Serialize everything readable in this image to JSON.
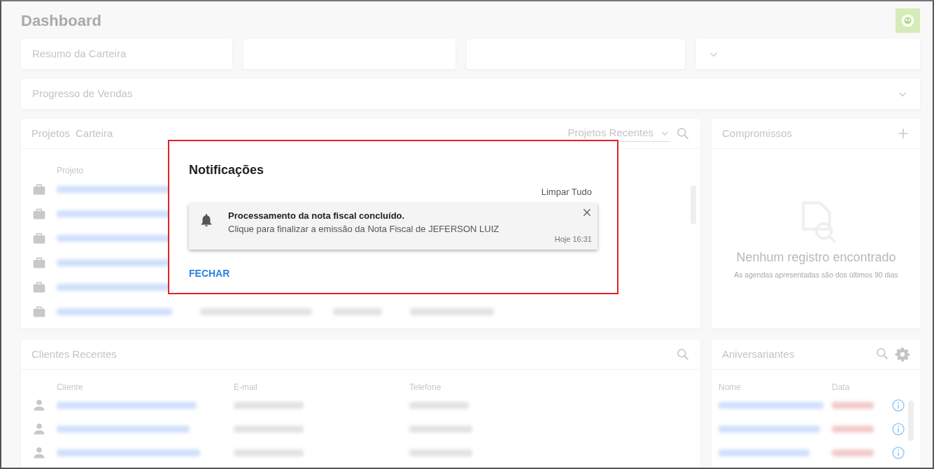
{
  "page": {
    "title": "Dashboard"
  },
  "summary_cards": [
    {
      "title": "Resumo da Carteira"
    }
  ],
  "progress_panel": {
    "title": "Progresso de Vendas"
  },
  "projects_panel": {
    "tabs": [
      "Projetos",
      "Carteira"
    ],
    "filter": "Projetos Recentes",
    "columns": [
      "Projeto"
    ]
  },
  "appointments_panel": {
    "title": "Compromissos",
    "empty_title": "Nenhum registro encontrado",
    "empty_note": "As agendas apresentadas são dos últimos 90 dias"
  },
  "clients_panel": {
    "title": "Clientes Recentes",
    "columns": [
      "Cliente",
      "E-mail",
      "Telefone"
    ]
  },
  "birthdays_panel": {
    "title": "Aniversariantes",
    "columns": [
      "Nome",
      "Data"
    ]
  },
  "notifications_dialog": {
    "title": "Notificações",
    "clear_all": "Limpar Tudo",
    "close_button": "FECHAR",
    "items": [
      {
        "title": "Processamento da nota fiscal concluído.",
        "message": "Clique para finalizar a emissão da Nota Fiscal de JEFERSON LUIZ",
        "time": "Hoje 16:31"
      }
    ]
  }
}
